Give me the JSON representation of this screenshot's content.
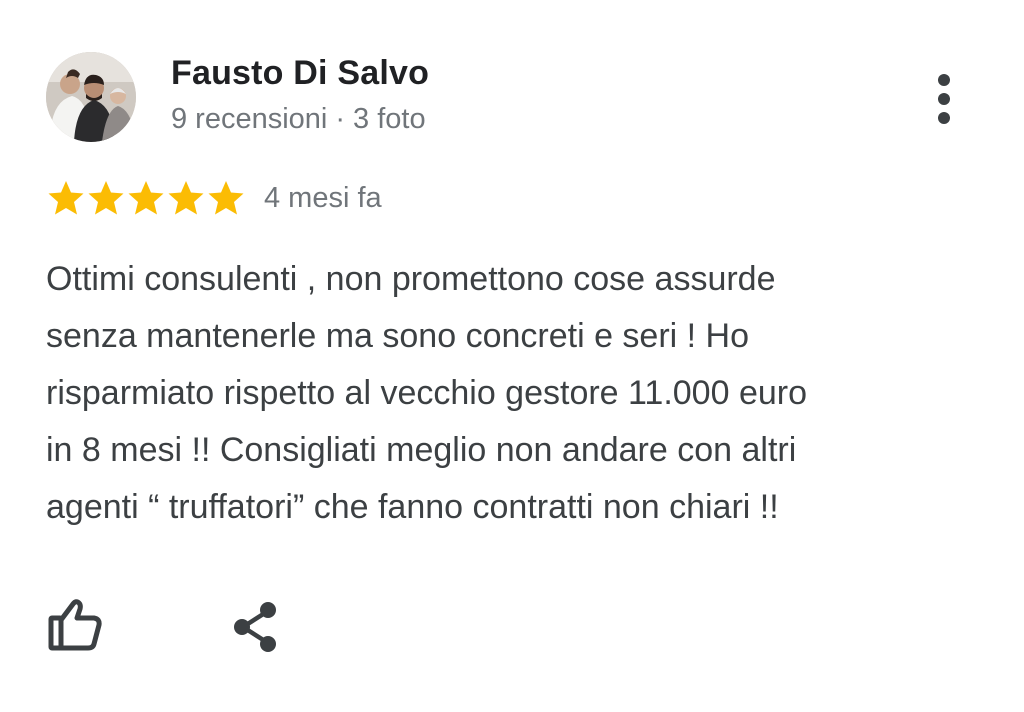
{
  "review": {
    "author": {
      "name": "Fausto Di Salvo",
      "reviews_count": "9 recensioni",
      "separator": "·",
      "photos_count": "3 foto",
      "avatar_icon": "profile-photo"
    },
    "rating": {
      "stars": 5,
      "max_stars": 5,
      "star_color": "#fbbc04",
      "time": "4 mesi fa"
    },
    "text_lines": [
      "Ottimi consulenti , non promettono cose assurde",
      "senza mantenerle ma sono concreti e seri ! Ho",
      "risparmiato rispetto al vecchio gestore 11.000 euro",
      "in 8 mesi !! Consigliati meglio non andare con altri",
      "agenti “ truffatori” che fanno contratti non chiari !!"
    ],
    "actions": {
      "like_icon": "thumbs-up-icon",
      "share_icon": "share-icon",
      "more_icon": "more-vert-icon"
    }
  },
  "colors": {
    "name": "#202124",
    "secondary": "#70757a",
    "body_text": "#3c4043",
    "icon": "#3c4043"
  }
}
